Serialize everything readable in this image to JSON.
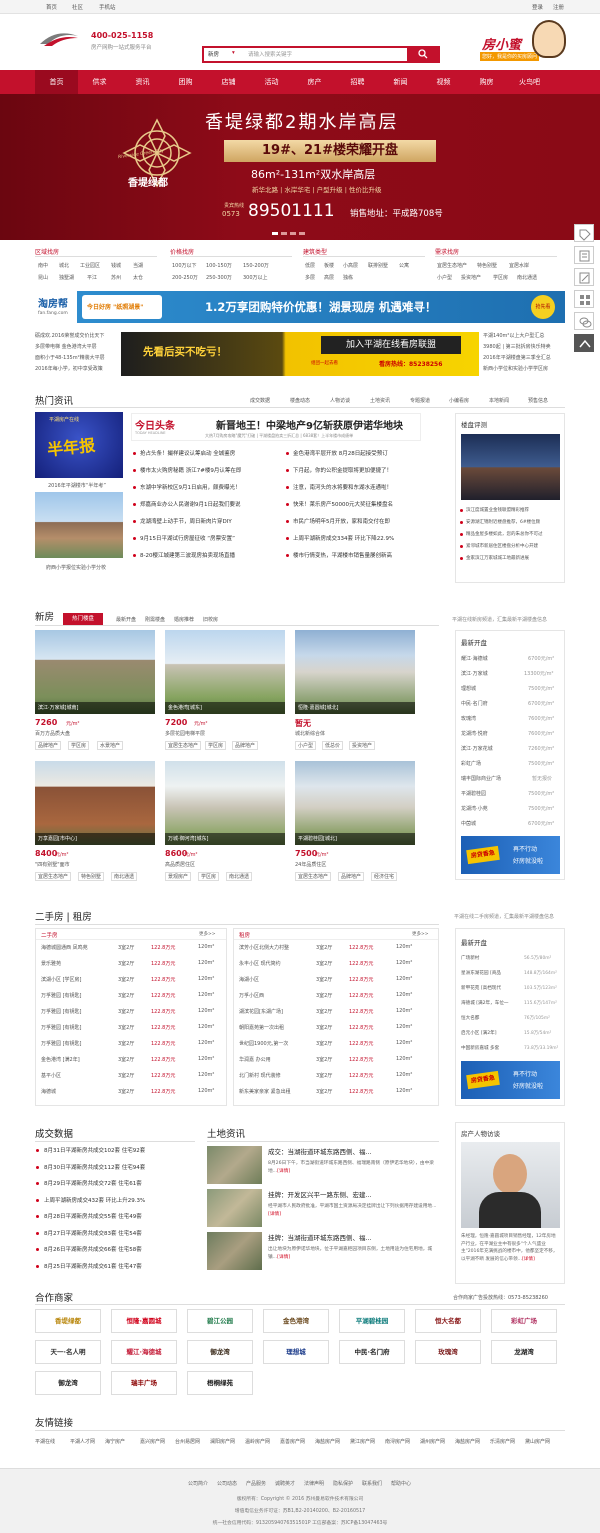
{
  "colors": {
    "brand": "#c3112c",
    "accent": "#d0021b",
    "dark": "#9a0a1f"
  },
  "topbar": {
    "links": [
      "首页",
      "社区",
      "手机站"
    ],
    "right": [
      "登录",
      "注册"
    ]
  },
  "header": {
    "phone": "400-025-1158",
    "slogan": "房产网购一站式服务平台",
    "search_type": "新房",
    "search_placeholder": "请输入搜索关键字",
    "mascot_title": "房小蜜",
    "mascot_sub": "您好，我是你的买房顾问"
  },
  "nav": [
    "首页",
    "供求",
    "资讯",
    "团购",
    "店铺",
    "活动",
    "房产",
    "招聘",
    "新闻",
    "视频",
    "购房",
    "火鸟吧"
  ],
  "banner": {
    "title": "香堤绿都2期水岸高层",
    "subtitle": "19#、21#楼荣耀开盘",
    "area": "86m²-131m²双水岸高层",
    "features": "新华北路 | 水岸华宅 | 户型升级 | 性价比升级",
    "hotline_label": "贵宾热线",
    "area_code": "0573",
    "phone": "89501111",
    "address": "销售地址：平成路708号",
    "logo_text": "香堤绿都",
    "logo_en": "Riverside Green City"
  },
  "filters": [
    {
      "title": "区域找房",
      "rows": [
        [
          "南中",
          "城北",
          "工业园区",
          "钱城",
          "当湖"
        ],
        [
          "昆山",
          "独墅湖",
          "平江",
          "苏州",
          "太仓"
        ]
      ]
    },
    {
      "title": "价格找房",
      "rows": [
        [
          "100万以下",
          "100-150万",
          "150-200万"
        ],
        [
          "200-250万",
          "250-300万",
          "300万以上"
        ]
      ]
    },
    {
      "title": "建筑类型",
      "rows": [
        [
          "低层",
          "板楼",
          "小高层",
          "联排别墅",
          "公寓"
        ],
        [
          "多层",
          "高层",
          "独栋"
        ]
      ]
    },
    {
      "title": "需求找房",
      "rows": [
        [
          "宜居生态地产",
          "特色别墅",
          "宜居水岸"
        ],
        [
          "小户型",
          "投资地产",
          "学区房",
          "南北通透"
        ]
      ]
    }
  ],
  "ad1": {
    "site": "淘房帮",
    "site_domain": "fan.fang.com",
    "promo": "今日好房 \"纸照湖景\"",
    "main": "1.2万享团购特价优惠！湖景现房 机遇难寻！",
    "badge": "抢先看"
  },
  "ad2": {
    "left": "砺成欢.2016荣誉成交价比天下",
    "left2": "多层带电梯 金色港湾大平层",
    "left3": "面积小于48-135m²精装大平层",
    "left4": "2016年每小学，初中享受政策",
    "mid1": "先看后买不吃亏！",
    "mid2": "加入平湖在线看房联盟",
    "mid3": "看房热线：85238256",
    "mid4": "组团一起去看",
    "right": "平湖140m²以上大户型汇总",
    "right2": "3980起 | 第三批拆房快乐特卖",
    "right3": "2016年平湖楼盘第三季全汇总",
    "right4": "新西小学位和实验小学学区房"
  },
  "news": {
    "title": "热门资讯",
    "tabs": [
      "成交数据",
      "楼盘动态",
      "人物访谈",
      "土地资讯",
      "专题报道",
      "小编看房",
      "本地新闻",
      "预售信息"
    ],
    "img1_caption": "2016年平湖楼市“半年考”",
    "img2_caption": "府西小学报位实验小学分校",
    "img1_text1": "平湖房产在线",
    "img1_text2": "半年报",
    "headline": "新晋地王！中梁地产9亿斩获原伊诺华地块",
    "headline_sub": "大热7月购房攻略\"魔咒\"打破 | 平湖楼盘拍卖三折汇总 | 6838套！上半年楼市成绩单",
    "today_label": "今日头条",
    "today_en": "TODAY HEADLINE",
    "left_list": [
      "抢占头条！撮样建议认筹启动 全城鉴房",
      "楼市太火购房秘籍 浙江7#楼9月认筹在即",
      "东湖中学新校区9月1日启用，颇费曝光！",
      "郑嘉商业办公人民谢谢9月1日起我们要说",
      "龙湖湾壁上动手节，周日新肉片穿DIY",
      "9月15日平湖试行房屋征收 “房票安置”",
      "8-20樱江城建第三波现房拍卖现场直播"
    ],
    "right_list": [
      "金色港湾平层开放 8月28日起接受预订",
      "下月起，你的公积金提取将更加便捷了！",
      "注意，南河头的水将要和东湖水连通啦！",
      "快来！莱乐房产50000元大奖征集楼盘名",
      "市民广场明年5月开放，家和南交付在即",
      "上周平湖新房成交334套 环比下降22.9%",
      "楼市行情变热，平湖楼市销售量屡创新高"
    ],
    "eval_title": "楼盘评测",
    "eval_list": [
      "滨江度城置业金钱联盟精彩推荐",
      "安源湖汇锦附近楼盘推荐，6#楼位颇",
      "精品金屋多楼如此，您的朱总你不可过",
      "紧邻城市新居住区楼盘分析中心开建",
      "金家滨江万家城城工地最新进展"
    ]
  },
  "newhouse": {
    "title": "新房",
    "tabs": [
      "热门楼盘",
      "最新开盘",
      "刚需楼盘",
      "婚房推荐",
      "旧校房"
    ],
    "note": "平湖在线新房频道，汇集最新平湖楼盘信息",
    "cards": [
      {
        "name": "滨江·万家城[城南]",
        "price": "7260",
        "unit": "元/m²",
        "desc": "百万方品质大盘",
        "tags": [
          "品牌地产",
          "学区房",
          "水景地产"
        ]
      },
      {
        "name": "金色港湾[城东]",
        "price": "7200",
        "unit": "元/m²",
        "desc": "多层花园电梯平层",
        "tags": [
          "宜居生态地产",
          "学区房",
          "品牌地产"
        ]
      },
      {
        "name": "恒隆·嘉圆城[城北]",
        "price": "暂无",
        "unit": "",
        "desc": "城北新综合体",
        "tags": [
          "小户型",
          "低总价",
          "投资地产"
        ]
      },
      {
        "name": "万享嘉园[市中心]",
        "price": "8400",
        "unit": "元/m²",
        "desc": "\"四有别墅\"面市",
        "tags": [
          "宜居生态地产",
          "特色别墅",
          "南北通透"
        ]
      },
      {
        "name": "万城·御河湾[城东]",
        "price": "8600",
        "unit": "元/m²",
        "desc": "高品质居住区",
        "tags": [
          "景观房产",
          "学区房",
          "南北通透"
        ]
      },
      {
        "name": "平湖碧桂园[城北]",
        "price": "7500",
        "unit": "元/m²",
        "desc": "24年品质住区",
        "tags": [
          "宜居生态地产",
          "品牌地产",
          "经济住宅"
        ]
      }
    ],
    "side_title": "最新开盘",
    "side_list": [
      [
        "耀江·海德城",
        "6700元/m²"
      ],
      [
        "滨江·万家城",
        "13300元/m²"
      ],
      [
        "理想城",
        "7500元/m²"
      ],
      [
        "中民·名门府",
        "6700元/m²"
      ],
      [
        "玫瑰湾",
        "7600元/m²"
      ],
      [
        "龙湖湾·悦府",
        "7600元/m²"
      ],
      [
        "滨江·万家花城",
        "7260元/m²"
      ],
      [
        "彩虹广场",
        "7500元/m²"
      ],
      [
        "瑞丰国际商业广场",
        "暂无报价"
      ],
      [
        "平湖碧桂园",
        "7500元/m²"
      ],
      [
        "龙湖湾·小苑",
        "7500元/m²"
      ],
      [
        "中茵城",
        "6700元/m²"
      ]
    ],
    "side_ad1": "房贷香急",
    "side_ad2": "再不行动",
    "side_ad3": "好房就没啦"
  },
  "second": {
    "title": "二手房 | 租房",
    "note": "平湖在线二手房频道，汇集最新平湖楼盘信息",
    "sale_title": "二手房",
    "rent_title": "租房",
    "more": "更多>>",
    "sale": [
      [
        "海德城圆通西 凤鸣苑",
        "3室2厅",
        "122.8万元",
        "120m²"
      ],
      [
        "景乐雅苑",
        "3室2厅",
        "122.8万元",
        "120m²"
      ],
      [
        "滨湖小区 [学区房]",
        "3室2厅",
        "122.8万元",
        "120m²"
      ],
      [
        "万孚雅园 [有钥匙]",
        "3室2厅",
        "122.8万元",
        "120m²"
      ],
      [
        "万孚雅园 [有钥匙]",
        "3室2厅",
        "122.8万元",
        "120m²"
      ],
      [
        "万孚雅园 [有钥匙]",
        "3室2厅",
        "122.8万元",
        "120m²"
      ],
      [
        "万孚雅园 [有钥匙]",
        "3室2厅",
        "122.8万元",
        "120m²"
      ],
      [
        "金色港湾 [满2年]",
        "3室2厅",
        "122.8万元",
        "120m²"
      ],
      [
        "基平小区",
        "3室2厅",
        "122.8万元",
        "120m²"
      ],
      [
        "海德城",
        "3室2厅",
        "122.8万元",
        "120m²"
      ]
    ],
    "rent": [
      [
        "滨芳小区北侧大力村整",
        "3室2厅",
        "122.8万元",
        "120m²"
      ],
      [
        "永丰小区 现代简约",
        "3室2厅",
        "122.8万元",
        "120m²"
      ],
      [
        "海湖小区",
        "3室2厅",
        "122.8万元",
        "120m²"
      ],
      [
        "万孚小区西",
        "3室2厅",
        "122.8万元",
        "120m²"
      ],
      [
        "湖滨花园[东湖广场]",
        "3室2厅",
        "122.8万元",
        "120m²"
      ],
      [
        "朝阳嘉苑第一次出租",
        "3室2厅",
        "122.8万元",
        "120m²"
      ],
      [
        "世纪园1900元,第一次",
        "3室2厅",
        "122.8万元",
        "120m²"
      ],
      [
        "华润嘉 办公用",
        "3室2厅",
        "122.8万元",
        "120m²"
      ],
      [
        "北门新村 现代装修",
        "3室2厅",
        "122.8万元",
        "120m²"
      ],
      [
        "新东美家亲家 紧急出租",
        "3室2厅",
        "122.8万元",
        "120m²"
      ]
    ],
    "side_title": "最新开盘",
    "side_list": [
      [
        "广场新村",
        "56.5万/80m²"
      ],
      [
        "星洲东湖花园 [商品",
        "148.8万/164m²"
      ],
      [
        "新甲花苑 [高档现代",
        "103.5万/123m²"
      ],
      [
        "海德城 [满2年，车位一",
        "115.6万/147m²"
      ],
      [
        "恒大名都",
        "76万/105m²"
      ],
      [
        "启元小区 [满2年]",
        "15.8万/54m²"
      ],
      [
        "中国新房嘉城 多套",
        "73.8万/33.19m²"
      ]
    ]
  },
  "deals": {
    "title": "成交数据",
    "list": [
      "8月31日平湖新房共成交102套 住宅92套",
      "8月30日平湖新房共成交112套 住宅94套",
      "8月29日平湖新房共成交72套 住宅61套",
      "上周平湖新房成交432套 环比上升29.3%",
      "8月28日平湖新房共成交55套 住宅49套",
      "8月27日平湖新房共成交83套 住宅54套",
      "8月26日平湖新房共成交66套 住宅58套",
      "8月25日平湖新房共成交61套 住宅47套"
    ]
  },
  "land": {
    "title": "土地资讯",
    "items": [
      {
        "title": "成交：当湖街道环城东路西侧、福...",
        "text": "8月26日下午，市当湖街道环城东路西侧、福瑞路南侧（原伊诺华地块），由中梁地...",
        "more": "[详情]"
      },
      {
        "title": "挂牌：开发区兴平一路东侧、宏建...",
        "text": "经平湖市人民政府批准，平湖市国土资源局决定挂牌出让下列伙据用存建设用地...",
        "more": "[详情]"
      },
      {
        "title": "挂牌：当湖街道环城东路西侧、福...",
        "text": "出让地块为原伊诺华地块，位于平湖嘉柜园项目东侧，土地用途为住宅用地，城镇...",
        "more": "[详情]"
      }
    ]
  },
  "interview": {
    "title": "房产人物访谈",
    "text": "朱经理，恒隆·嘉圆城项目销售经理，12年房地产行业，在平湖业主中有很多\"个人气盛业主\"2016年充满挑战的楼市中，他都坚定不移，以平湖不断 发展的信心带领...",
    "more": "[详情]"
  },
  "partners": {
    "title": "合作商家",
    "hotline": "合作商家广告投放热线：0573-85238260",
    "logos": [
      "香堤绿都",
      "恒隆·嘉圆城",
      "碧江公园",
      "金色港湾",
      "平湖碧桂园",
      "恒大名都",
      "彩虹广场",
      "天一·名人明",
      "耀江·海德城",
      "御龙湾",
      "理想城",
      "中民·名门府",
      "玫瑰湾",
      "龙湖湾",
      "御龙湾",
      "瑞丰广场",
      "梧桐绿苑"
    ]
  },
  "friend": {
    "title": "友情链接",
    "links": [
      "平湖在线",
      "平湖人才网",
      "海宁房产",
      "嘉兴房产网",
      "台州易居网",
      "澜阳房产网",
      "温岭房产网",
      "嘉善房产网",
      "海盐房产网",
      "黛江房产网",
      "南浔房产网",
      "湖州房产网",
      "海盐房产网",
      "乐清房产网",
      "黛山房产网"
    ]
  },
  "footer": {
    "links": [
      "公司简介",
      "公司动态",
      "产品服务",
      "诚聘英才",
      "法律声明",
      "隐私保护",
      "联系我们",
      "帮助中心"
    ],
    "line1": "版权所有：Copyright © 2016 苏州曼易软件技术有限公司",
    "line2": "增值电信业务许可证：苏B1,B2-20140200、B2-20160517",
    "line3": "统一社会信用代码：91320594076351501P 工信部备案：苏ICP备13047463号"
  }
}
